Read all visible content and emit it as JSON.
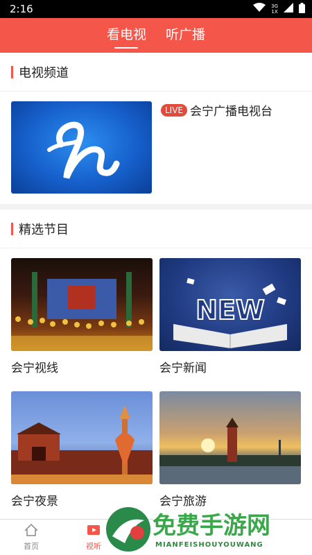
{
  "status": {
    "time": "2:16",
    "net_top": "3G",
    "net_bottom": "1X"
  },
  "header": {
    "tabs": [
      {
        "label": "看电视"
      },
      {
        "label": "听广播"
      }
    ]
  },
  "tv_section": {
    "title": "电视频道",
    "channel": {
      "live_badge": "LIVE",
      "name": "会宁广播电视台"
    }
  },
  "featured_section": {
    "title": "精选节目",
    "items": [
      {
        "label": "会宁视线"
      },
      {
        "label": "会宁新闻"
      },
      {
        "label": "会宁夜景"
      },
      {
        "label": "会宁旅游"
      }
    ]
  },
  "bottom_nav": {
    "items": [
      {
        "label": "首页",
        "icon": "home-icon"
      },
      {
        "label": "视听",
        "icon": "play-icon"
      }
    ]
  },
  "watermark": {
    "text": "免费手游网",
    "sub": "MIANFEISHOUYOUWANG"
  },
  "colors": {
    "accent": "#f4564a"
  }
}
